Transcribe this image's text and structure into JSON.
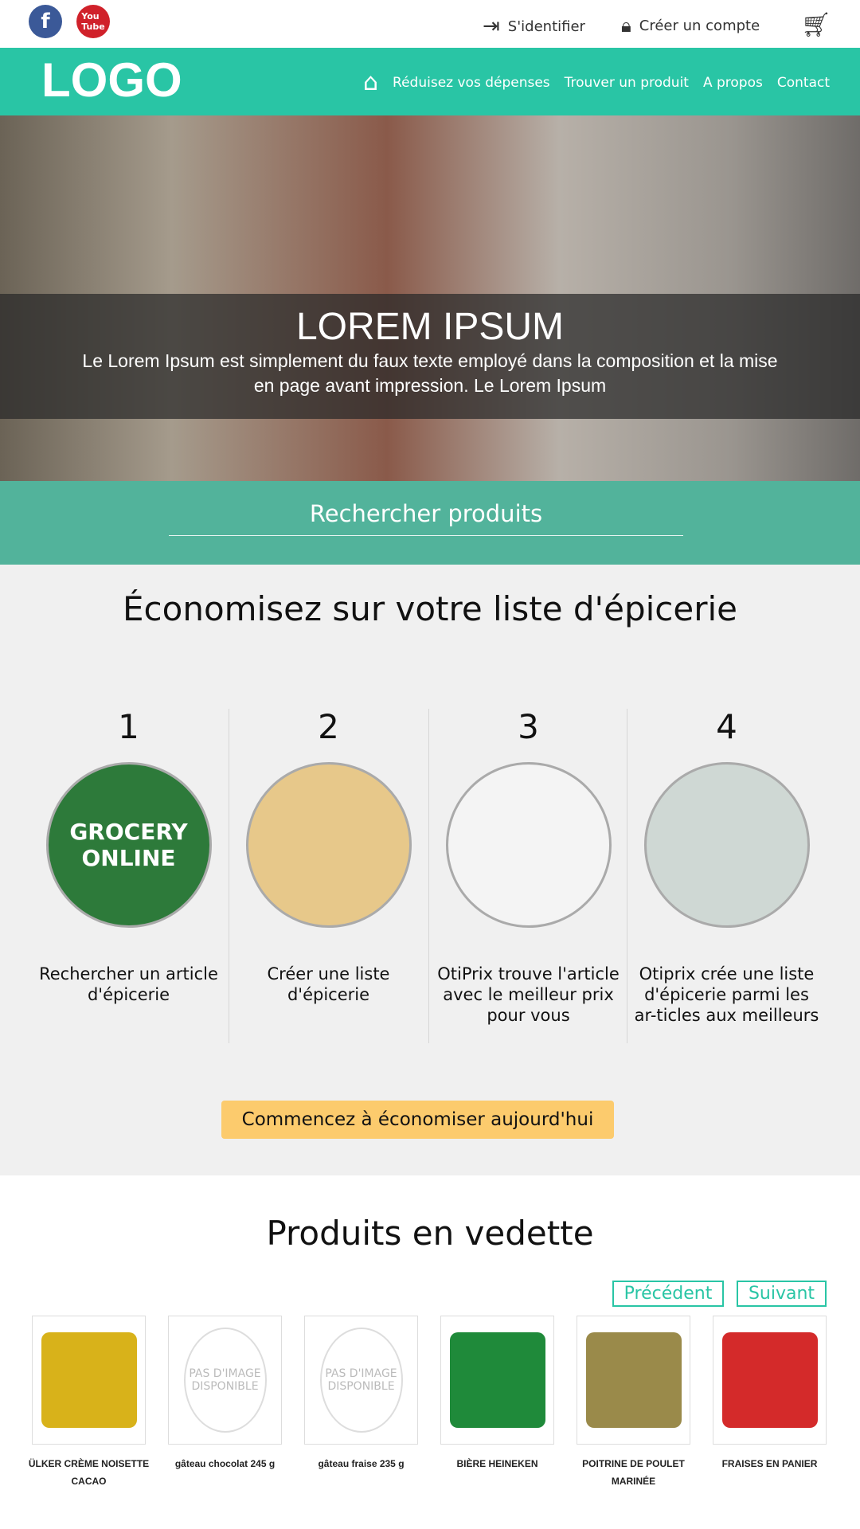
{
  "topbar": {
    "login": "S'identifier",
    "register": "Créer un compte"
  },
  "nav": {
    "logo": "LOGO",
    "items": [
      "Réduisez vos dépenses",
      "Trouver un produit",
      "A propos",
      "Contact"
    ]
  },
  "hero": {
    "title": "LOREM IPSUM",
    "text": "Le Lorem Ipsum est simplement du faux texte employé dans la composition et la mise en page avant impression. Le Lorem Ipsum"
  },
  "search": {
    "label": "Rechercher produits"
  },
  "steps_section": {
    "title": "Économisez sur votre liste d'épicerie",
    "steps": [
      {
        "num": "1",
        "text": "Rechercher un article d'épicerie",
        "image": "GROCERY ONLINE"
      },
      {
        "num": "2",
        "text": "Créer une liste d'épicerie",
        "image": ""
      },
      {
        "num": "3",
        "text": "OtiPrix trouve l'article avec le meilleur prix pour vous",
        "image": ""
      },
      {
        "num": "4",
        "text": "Otiprix crée une liste d'épicerie parmi les ar-ticles aux meilleurs",
        "image": ""
      }
    ],
    "cta": "Commencez à économiser aujourd'hui"
  },
  "featured": {
    "title": "Produits en vedette",
    "prev": "Précédent",
    "next": "Suivant",
    "no_image": "PAS D'IMAGE DISPONIBLE",
    "products": [
      {
        "name": "ÜLKER CRÈME NOISETTE CACAO",
        "color": "#d8b21a"
      },
      {
        "name": "gâteau chocolat 245 g",
        "color": ""
      },
      {
        "name": "gâteau fraise 235 g",
        "color": ""
      },
      {
        "name": "BIÈRE HEINEKEN",
        "color": "#1f8a3a"
      },
      {
        "name": "POITRINE DE POULET MARINÉE",
        "color": "#9a8a4a"
      },
      {
        "name": "FRAISES EN PANIER",
        "color": "#d42a2a"
      }
    ]
  },
  "colors": {
    "teal": "#29c5a5",
    "search": "#52b39b",
    "cta": "#fccb6d"
  }
}
